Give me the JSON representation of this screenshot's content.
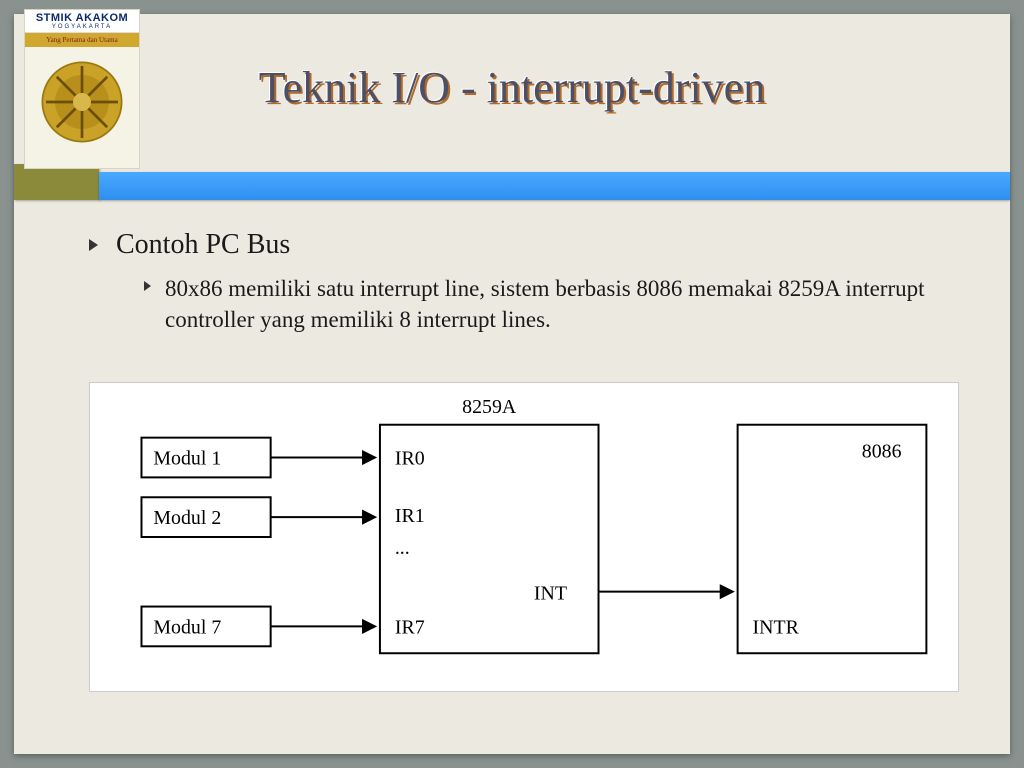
{
  "logo": {
    "title": "STMIK AKAKOM",
    "subtitle": "YOGYAKARTA",
    "motto": "Yang Pertama dan Utama"
  },
  "slide": {
    "title": "Teknik I/O - interrupt-driven"
  },
  "bullets": {
    "main": "Contoh PC Bus",
    "sub": "80x86 memiliki satu interrupt line, sistem berbasis 8086 memakai 8259A interrupt controller yang memiliki 8 interrupt lines."
  },
  "diagram": {
    "controller_label": "8259A",
    "cpu_label": "8086",
    "modules": [
      "Modul 1",
      "Modul 2",
      "Modul 7"
    ],
    "ir_lines": [
      "IR0",
      "IR1",
      "...",
      "IR7"
    ],
    "int_out": "INT",
    "intr_in": "INTR"
  }
}
